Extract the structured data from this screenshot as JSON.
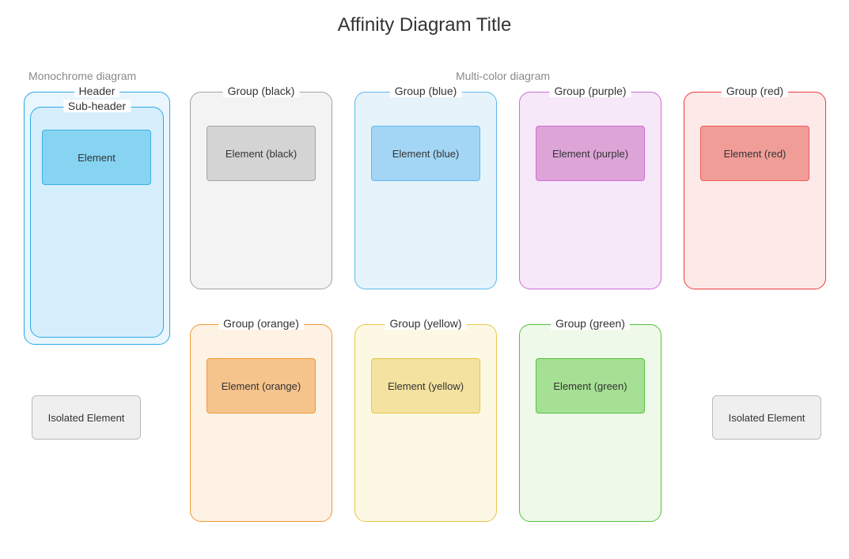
{
  "title": "Affinity Diagram Title",
  "sections": {
    "monochrome": "Monochrome diagram",
    "multicolor": "Multi-color diagram"
  },
  "monochrome": {
    "header_label": "Header",
    "subheader_label": "Sub-header",
    "element_label": "Element"
  },
  "groups": {
    "black": {
      "label": "Group (black)",
      "element": "Element (black)"
    },
    "blue": {
      "label": "Group (blue)",
      "element": "Element (blue)"
    },
    "purple": {
      "label": "Group (purple)",
      "element": "Element (purple)"
    },
    "red": {
      "label": "Group (red)",
      "element": "Element (red)"
    },
    "orange": {
      "label": "Group (orange)",
      "element": "Element (orange)"
    },
    "yellow": {
      "label": "Group (yellow)",
      "element": "Element (yellow)"
    },
    "green": {
      "label": "Group (green)",
      "element": "Element (green)"
    }
  },
  "isolated": {
    "left": "Isolated Element",
    "right": "Isolated Element"
  },
  "colors": {
    "mono_header_border": "#2ca8e8",
    "mono_header_fill": "#eaf6fd",
    "mono_sub_border": "#2ca8e8",
    "mono_sub_fill": "#d6eefc",
    "mono_elem_border": "#3db1e8",
    "mono_elem_fill": "#87d4f2",
    "black_border": "#a3a3a3",
    "black_fill": "#f3f3f3",
    "black_elem_border": "#a3a3a3",
    "black_elem_fill": "#d4d4d4",
    "blue_border": "#5fb9ee",
    "blue_fill": "#e6f3fb",
    "blue_elem_border": "#5fb9ee",
    "blue_elem_fill": "#a3d6f5",
    "purple_border": "#cd6cd6",
    "purple_fill": "#f6e8f8",
    "purple_elem_border": "#cd6cd6",
    "purple_elem_fill": "#dda4d8",
    "red_border": "#ef3a3a",
    "red_fill": "#fde9e8",
    "red_elem_border": "#ef5a5a",
    "red_elem_fill": "#f09d98",
    "orange_border": "#f09a3a",
    "orange_fill": "#fdf2e3",
    "orange_elem_border": "#f09a3a",
    "orange_elem_fill": "#f5c38c",
    "yellow_border": "#e8c64a",
    "yellow_fill": "#fcf8e3",
    "yellow_elem_border": "#e8c64a",
    "yellow_elem_fill": "#f3e2a0",
    "green_border": "#56c040",
    "green_fill": "#eef9ea",
    "green_elem_border": "#56c040",
    "green_elem_fill": "#a6e094"
  }
}
